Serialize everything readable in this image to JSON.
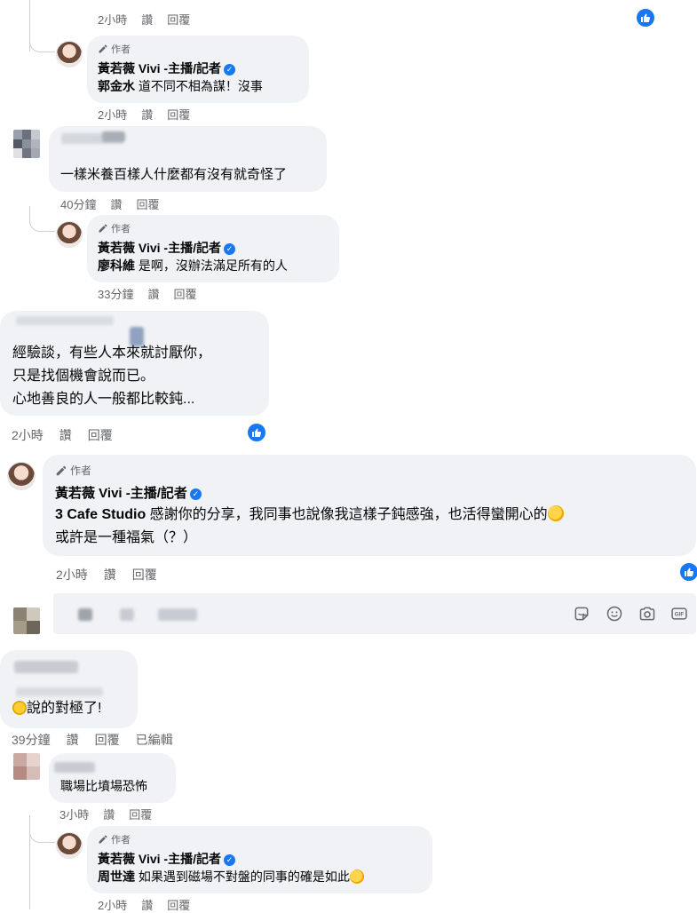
{
  "labels": {
    "like": "讚",
    "reply": "回覆",
    "author": "作者",
    "edited": "已編輯"
  },
  "author": {
    "name": "黃若薇 Vivi -主播/記者"
  },
  "top": {
    "time": "2小時"
  },
  "reply1": {
    "mention": "郭金水",
    "text": " 道不同不相為謀！沒事",
    "time": "2小時"
  },
  "c1": {
    "text": "一樣米養百樣人什麼都有沒有就奇怪了",
    "time": "40分鐘"
  },
  "reply2": {
    "mention": "廖科維",
    "text": " 是啊，沒辦法滿足所有的人",
    "time": "33分鐘"
  },
  "c2": {
    "lines": [
      "經驗談，有些人本來就討厭你，",
      "只是找個機會說而已。",
      "心地善良的人一般都比較鈍..."
    ],
    "time": "2小時"
  },
  "reply3": {
    "mention": "3 Cafe Studio",
    "text": " 感謝你的分享，我同事也說像我這樣子鈍感強，也活得蠻開心的",
    "line2": "或許是一種福氣（？）",
    "time": "2小時"
  },
  "c3": {
    "text": "說的對極了!",
    "time": "39分鐘"
  },
  "c4": {
    "text": "職場比墳場恐怖",
    "time": "3小時"
  },
  "reply4": {
    "mention": "周世達",
    "text": " 如果遇到磁場不對盤的同事的確是如此",
    "time": "2小時"
  },
  "icons": [
    "pencil-icon",
    "verified-badge-icon",
    "like-reaction-icon",
    "sticker-icon",
    "emoji-icon",
    "camera-icon",
    "gif-icon",
    "rofl-emoji",
    "laughing-emoji",
    "clap-emoji"
  ],
  "colors": {
    "accent": "#1877f2",
    "bubble": "#f0f2f5",
    "meta": "#65676b"
  }
}
